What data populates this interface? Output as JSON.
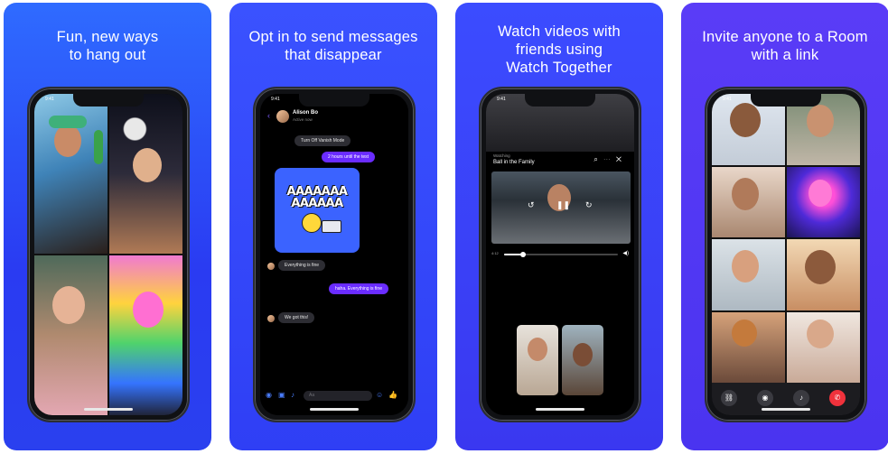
{
  "colors": {
    "messenger_blue": "#2f4bff",
    "purple_bubble": "#6a2cff",
    "end_call_red": "#f0323c"
  },
  "cards": [
    {
      "headline": "Fun, new ways\nto hang out",
      "time": "9:41"
    },
    {
      "headline": "Opt in to send messages\nthat disappear",
      "time": "9:41",
      "chat": {
        "name": "Alison Bo",
        "status": "Active now",
        "system_notice": "Turn Off Vanish Mode",
        "msg_right_1": "2 hours until the test",
        "sticker_text": "AAAAAAA\nAAAAAA",
        "msg_left_1": "Everything is fine",
        "msg_right_2": "haha. Everything is fine",
        "msg_left_2": "We got this!",
        "composer_placeholder": "Aa"
      }
    },
    {
      "headline": "Watch videos with\nfriends using\nWatch Together",
      "time": "9:41",
      "watch": {
        "label": "Watching",
        "title": "Ball in the Family",
        "elapsed": "4:12",
        "progress_fraction": 0.17
      }
    },
    {
      "headline": "Invite anyone to a Room\nwith a link",
      "time": "9:41"
    }
  ],
  "icons": {
    "back": "chevron-left-icon",
    "search": "search-icon",
    "more": "more-icon",
    "close": "close-icon",
    "link": "link-icon",
    "camera": "camera-icon",
    "mic": "mic-icon",
    "end_call": "end-call-icon"
  }
}
